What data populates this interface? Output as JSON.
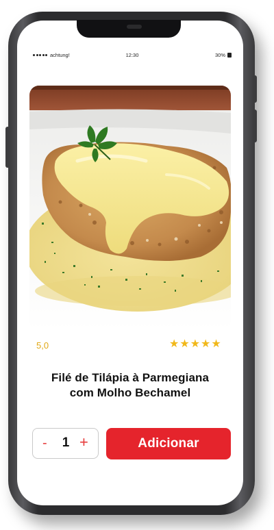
{
  "status_bar": {
    "carrier": "achtung!",
    "time": "12:30",
    "battery": "30%"
  },
  "product": {
    "image_alt": "Filé de Tilápia à Parmegiana com Molho Bechamel",
    "rating_value": "5,0",
    "stars": [
      "★",
      "★",
      "★",
      "★",
      "★"
    ],
    "title_line1": "Filé de Tilápia à Parmegiana",
    "title_line2": "com Molho Bechamel"
  },
  "cart": {
    "minus_label": "-",
    "quantity": "1",
    "plus_label": "+",
    "add_button_label": "Adicionar"
  },
  "colors": {
    "accent_red": "#e5242c",
    "star_yellow": "#f1b81a",
    "rating_text": "#e0a816"
  },
  "icons": [
    "signal-icon",
    "battery-icon",
    "star-icon"
  ]
}
